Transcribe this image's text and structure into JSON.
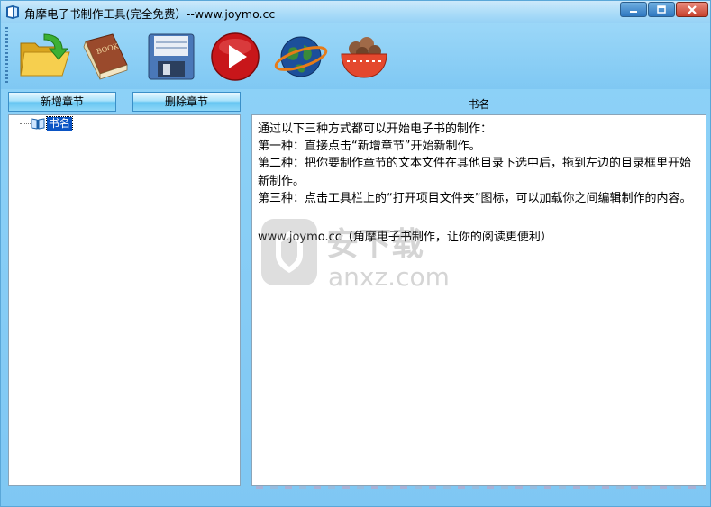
{
  "window": {
    "title": "角摩电子书制作工具(完全免费）--www.joymo.cc",
    "controls": [
      "minimize-icon",
      "maximize-icon",
      "close-icon"
    ]
  },
  "toolbar": {
    "tools": [
      {
        "name": "open-project-folder",
        "icon": "folder-open-arrow-icon"
      },
      {
        "name": "book",
        "icon": "book-icon",
        "icon_text": "BOOK"
      },
      {
        "name": "save",
        "icon": "floppy-disk-icon"
      },
      {
        "name": "generate",
        "icon": "play-icon"
      },
      {
        "name": "website",
        "icon": "globe-icon"
      },
      {
        "name": "about",
        "icon": "bowl-icon"
      }
    ]
  },
  "left_panel": {
    "add_chapter_label": "新增章节",
    "delete_chapter_label": "删除章节",
    "tree": {
      "root_label": "书名",
      "root_icon": "open-book-icon",
      "selected": true
    }
  },
  "right_panel": {
    "book_name_label": "书名",
    "content": {
      "line1": "通过以下三种方式都可以开始电子书的制作：",
      "line2": "第一种：直接点击“新增章节”开始新制作。",
      "line3": "第二种：把你要制作章节的文本文件在其他目录下选中后，拖到左边的目录框里开始新制作。",
      "line4": "第三种：点击工具栏上的“打开项目文件夹”图标，可以加载你之间编辑制作的内容。",
      "line5": "www.joymo.cc（角摩电子书制作，让你的阅读更便利）"
    }
  },
  "watermark": {
    "text_cn": "安下载",
    "text_en": "anxz.com"
  },
  "colors": {
    "window_bg": "#86cdf7",
    "selection": "#0a54c4",
    "close_button": "#c7422e"
  }
}
